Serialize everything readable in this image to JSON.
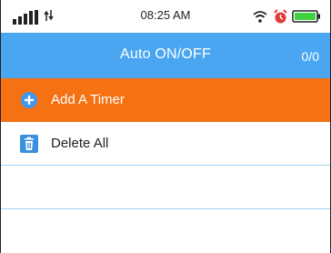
{
  "status_bar": {
    "time": "08:25 AM",
    "icons": [
      "signal-icon",
      "data-transfer-icon",
      "wifi-icon",
      "alarm-icon",
      "battery-icon"
    ]
  },
  "app_bar": {
    "title": "Auto ON/OFF",
    "count": "0/0",
    "color": "#4aa6f0"
  },
  "menu": {
    "items": [
      {
        "label": "Add A Timer",
        "icon": "add-circle-icon",
        "color": "#f57214"
      },
      {
        "label": "Delete All",
        "icon": "trash-icon",
        "icon_color": "#3a8fe0"
      }
    ]
  }
}
